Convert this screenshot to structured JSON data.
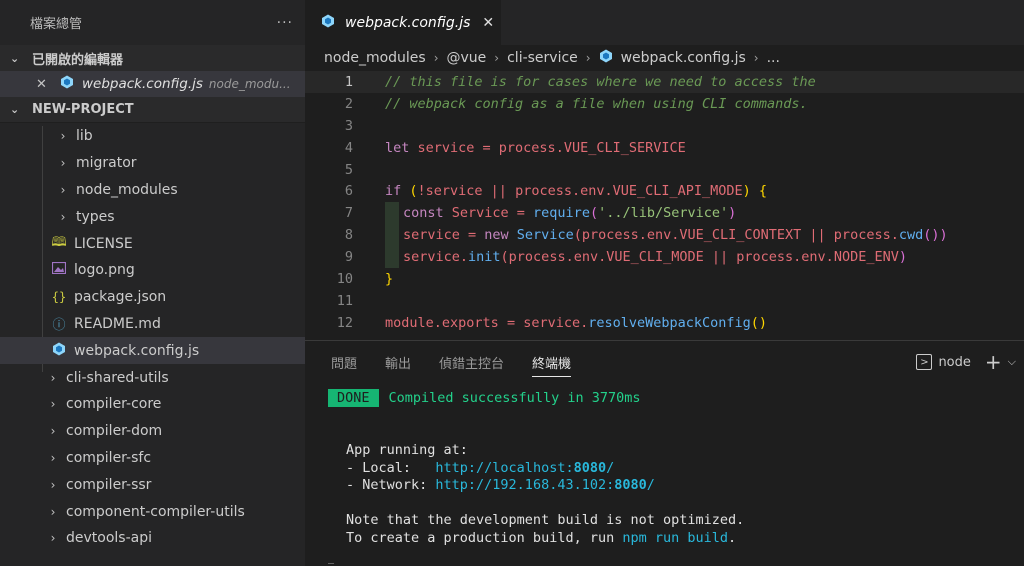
{
  "sidebar": {
    "title": "檔案總管",
    "more_label": "···",
    "open_editors_title": "已開啟的編輯器",
    "open_editor": {
      "close": "✕",
      "name": "webpack.config.js",
      "path": "node_modu..."
    },
    "project_title": "NEW-PROJECT",
    "tree": [
      {
        "label": "lib",
        "type": "folder"
      },
      {
        "label": "migrator",
        "type": "folder"
      },
      {
        "label": "node_modules",
        "type": "folder"
      },
      {
        "label": "types",
        "type": "folder"
      },
      {
        "label": "LICENSE",
        "type": "license"
      },
      {
        "label": "logo.png",
        "type": "image"
      },
      {
        "label": "package.json",
        "type": "json"
      },
      {
        "label": "README.md",
        "type": "info"
      },
      {
        "label": "webpack.config.js",
        "type": "webpack"
      },
      {
        "label": "cli-shared-utils",
        "type": "folder"
      },
      {
        "label": "compiler-core",
        "type": "folder"
      },
      {
        "label": "compiler-dom",
        "type": "folder"
      },
      {
        "label": "compiler-sfc",
        "type": "folder"
      },
      {
        "label": "compiler-ssr",
        "type": "folder"
      },
      {
        "label": "component-compiler-utils",
        "type": "folder"
      },
      {
        "label": "devtools-api",
        "type": "folder"
      }
    ]
  },
  "editor": {
    "tab": {
      "name": "webpack.config.js",
      "close": "✕"
    },
    "breadcrumb": [
      "node_modules",
      "@vue",
      "cli-service",
      "webpack.config.js",
      "..."
    ],
    "line_numbers": [
      "1",
      "2",
      "3",
      "4",
      "5",
      "6",
      "7",
      "8",
      "9",
      "10",
      "11",
      "12"
    ],
    "code": {
      "l1": "// this file is for cases where we need to access the",
      "l2": "// webpack config as a file when using CLI commands.",
      "l4_kw": "let",
      "l4_rest": " service = process.",
      "l4_prop": "VUE_CLI_SERVICE",
      "l6_kw": "if",
      "l6_a": " (",
      "l6_b": "!service || process.env.",
      "l6_prop": "VUE_CLI_API_MODE",
      "l6_c": ") {",
      "l7_kw": "const",
      "l7_a": " Service = ",
      "l7_fn": "require",
      "l7_p1": "(",
      "l7_str": "'../lib/Service'",
      "l7_p2": ")",
      "l8_a": "service = ",
      "l8_kw": "new",
      "l8_fn": " Service",
      "l8_b": "(process.env.",
      "l8_prop": "VUE_CLI_CONTEXT",
      "l8_c": " || process.",
      "l8_fn2": "cwd",
      "l8_d": "())",
      "l9_a": "service.",
      "l9_fn": "init",
      "l9_b": "(process.env.",
      "l9_prop": "VUE_CLI_MODE",
      "l9_c": " || process.env.",
      "l9_prop2": "NODE_ENV",
      "l9_d": ")",
      "l10": "}",
      "l12_a": "module.",
      "l12_prop": "exports",
      "l12_b": " = service.",
      "l12_fn": "resolveWebpackConfig",
      "l12_c": "()"
    }
  },
  "panel": {
    "tabs": [
      "問題",
      "輸出",
      "偵錯主控台",
      "終端機"
    ],
    "active_tab": "終端機",
    "shell": "node",
    "add": "+",
    "dropdown": "⌵",
    "terminal": {
      "done_badge": "DONE",
      "compiled": "Compiled successfully in 3770ms",
      "app_running": "App running at:",
      "local_label": "- Local:   ",
      "local_url": "http://localhost:",
      "local_port": "8080",
      "local_slash": "/",
      "network_label": "- Network: ",
      "network_url": "http://192.168.43.102:",
      "network_port": "8080",
      "network_slash": "/",
      "note1": "Note that the development build is not optimized.",
      "note2_a": "To create a production build, run ",
      "note2_cmd": "npm run build",
      "note2_b": "."
    }
  },
  "colors": {
    "accent_done": "#16b573",
    "link": "#29b8db"
  }
}
